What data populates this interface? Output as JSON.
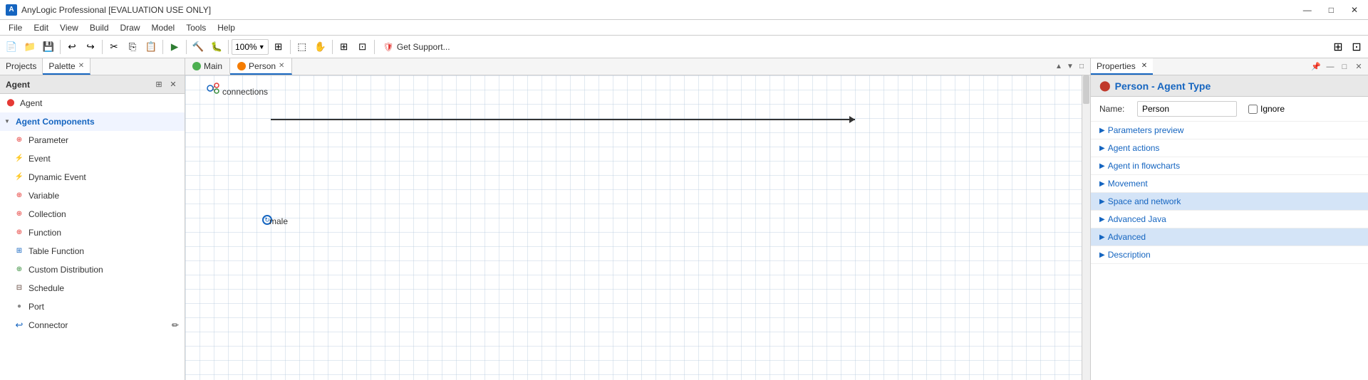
{
  "titleBar": {
    "appName": "AnyLogic Professional [EVALUATION USE ONLY]",
    "minimize": "—",
    "maximize": "□",
    "close": "✕"
  },
  "menuBar": {
    "items": [
      "File",
      "Edit",
      "View",
      "Build",
      "Draw",
      "Model",
      "Tools",
      "Help"
    ]
  },
  "toolbar": {
    "zoom": "100%",
    "getSupportLabel": "Get Support..."
  },
  "leftPanel": {
    "tabs": [
      {
        "label": "Projects",
        "active": false
      },
      {
        "label": "Palette",
        "active": true
      }
    ],
    "paletteTitle": "Agent",
    "items": [
      {
        "label": "Agent",
        "indent": false,
        "type": "agent",
        "isSection": false
      },
      {
        "label": "Agent Components",
        "indent": false,
        "type": "section",
        "isSection": true
      },
      {
        "label": "Parameter",
        "indent": true,
        "type": "param"
      },
      {
        "label": "Event",
        "indent": true,
        "type": "event"
      },
      {
        "label": "Dynamic Event",
        "indent": true,
        "type": "dynamic-event"
      },
      {
        "label": "Variable",
        "indent": true,
        "type": "variable"
      },
      {
        "label": "Collection",
        "indent": true,
        "type": "collection"
      },
      {
        "label": "Function",
        "indent": true,
        "type": "function"
      },
      {
        "label": "Table Function",
        "indent": true,
        "type": "table-function"
      },
      {
        "label": "Custom Distribution",
        "indent": true,
        "type": "custom-dist"
      },
      {
        "label": "Schedule",
        "indent": true,
        "type": "schedule"
      },
      {
        "label": "Port",
        "indent": true,
        "type": "port"
      },
      {
        "label": "Connector",
        "indent": true,
        "type": "connector"
      }
    ]
  },
  "canvasTabs": [
    {
      "label": "Main",
      "active": false,
      "color": "#4caf50"
    },
    {
      "label": "Person",
      "active": true,
      "color": "#f57c00"
    }
  ],
  "canvas": {
    "connectionsLabel": "connections",
    "maleLabel": "male"
  },
  "rightPanel": {
    "tabLabel": "Properties",
    "header": {
      "title": "Person - Agent Type"
    },
    "nameLabel": "Name:",
    "nameValue": "Person",
    "ignoreLabel": "Ignore",
    "sections": [
      {
        "label": "Parameters preview",
        "key": "params-preview"
      },
      {
        "label": "Agent actions",
        "key": "agent-actions"
      },
      {
        "label": "Agent in flowcharts",
        "key": "agent-flowcharts"
      },
      {
        "label": "Movement",
        "key": "movement"
      },
      {
        "label": "Space and network",
        "key": "space-network",
        "highlighted": true
      },
      {
        "label": "Advanced Java",
        "key": "advanced-java"
      },
      {
        "label": "Advanced",
        "key": "advanced",
        "highlighted": true
      },
      {
        "label": "Description",
        "key": "description"
      }
    ]
  }
}
